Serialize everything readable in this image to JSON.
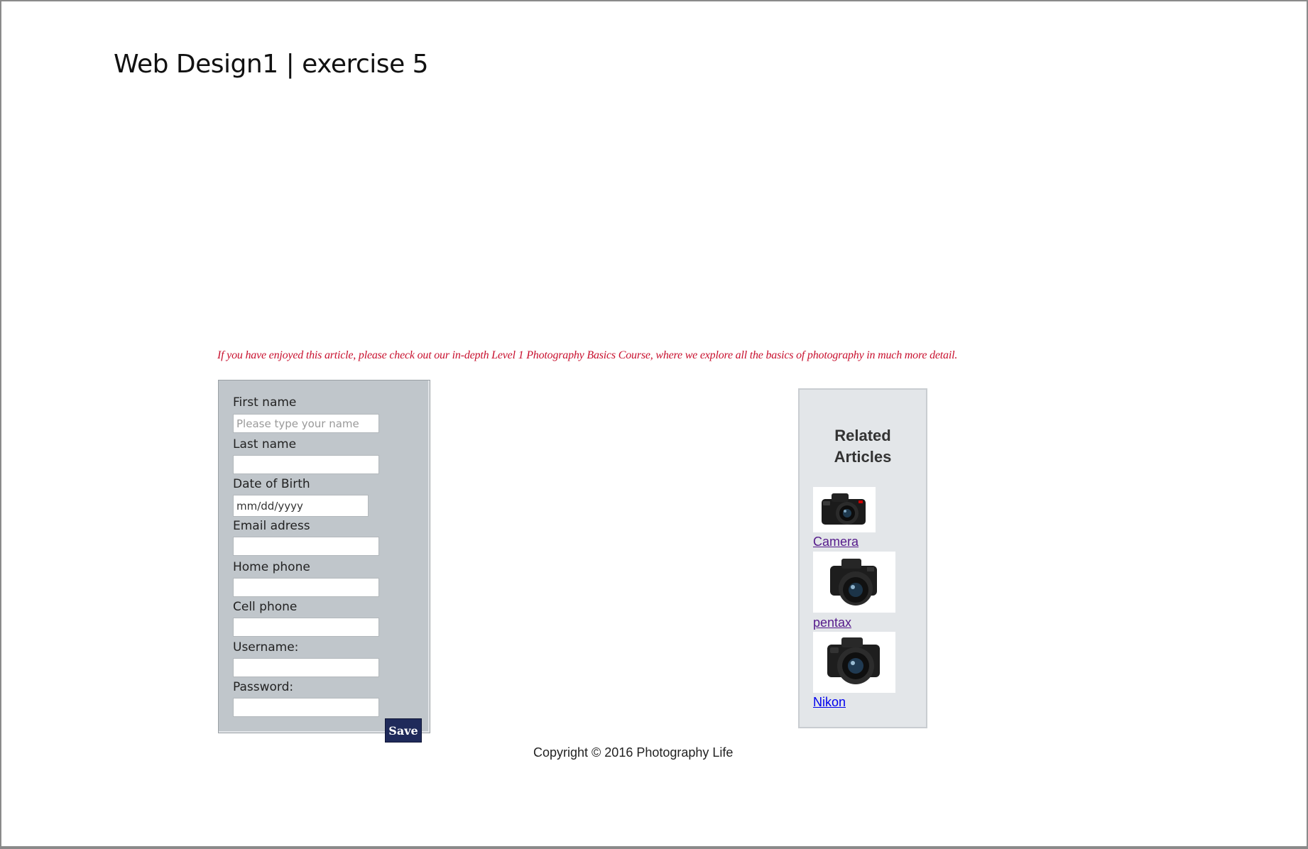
{
  "document": {
    "title": "Web Design1 | exercise 5"
  },
  "promo": {
    "text": "If you have enjoyed this article, please check out our in-depth Level 1 Photography Basics Course, where we explore all the basics of photography in much more detail."
  },
  "form": {
    "first_name_label": "First name",
    "first_name_placeholder": "Please type your name",
    "last_name_label": "Last name",
    "dob_label": "Date of Birth",
    "dob_value": "mm/dd/yyyy",
    "email_label": "Email adress",
    "home_phone_label": "Home phone",
    "cell_phone_label": "Cell phone",
    "username_label": "Username:",
    "password_label": "Password:",
    "save_label": "Save"
  },
  "related": {
    "title": "Related Articles",
    "articles": [
      {
        "label": "Camera",
        "icon": "camera-icon"
      },
      {
        "label": "pentax",
        "icon": "camera-icon"
      },
      {
        "label": "Nikon",
        "icon": "camera-icon"
      }
    ]
  },
  "footer": {
    "copyright": "Copyright © 2016 Photography Life"
  }
}
